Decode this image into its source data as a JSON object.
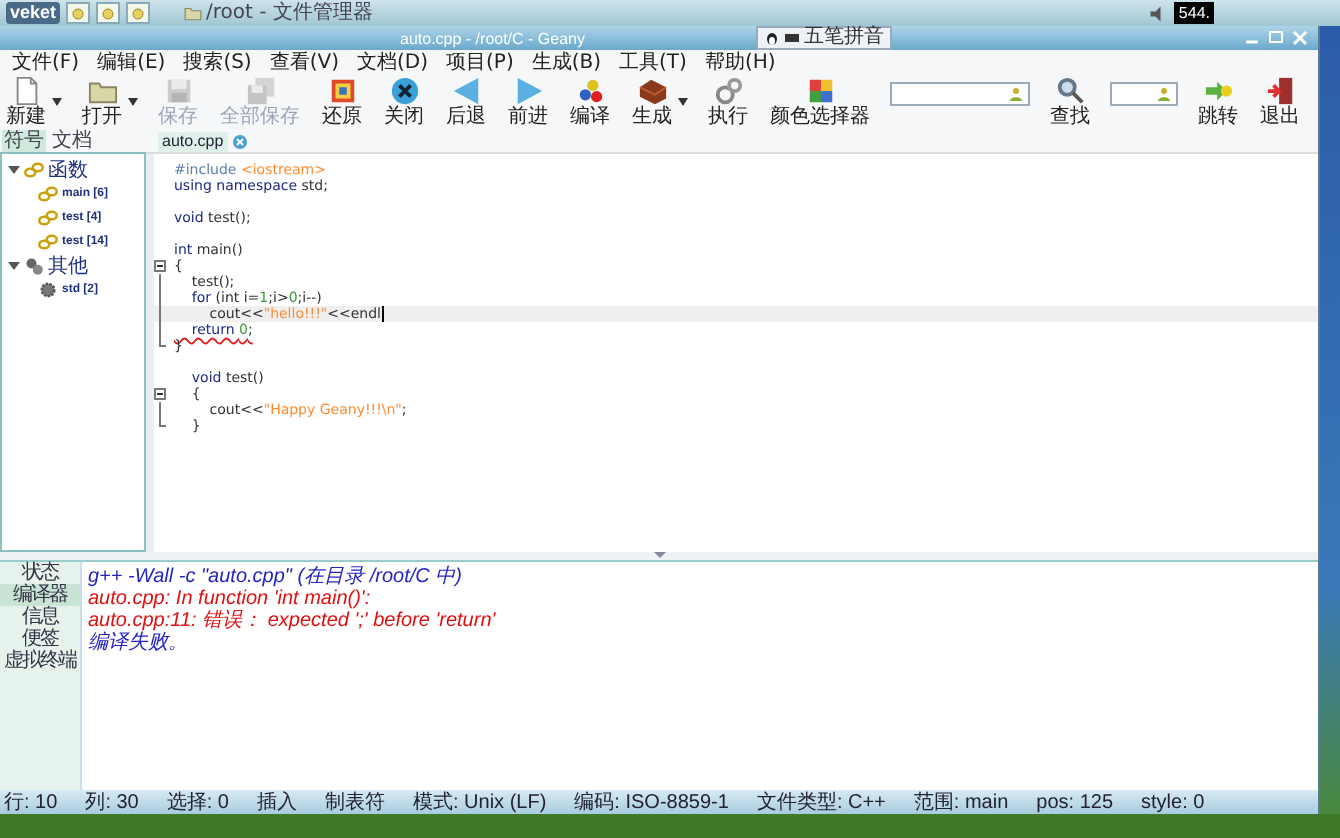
{
  "taskbar": {
    "logo": "veket",
    "tasks": [
      {
        "label": "/root - 文件管理器"
      }
    ],
    "clock": "544."
  },
  "window": {
    "title": "auto.cpp - /root/C - Geany",
    "ime": "五笔拼音"
  },
  "menu": [
    "文件(F)",
    "编辑(E)",
    "搜索(S)",
    "查看(V)",
    "文档(D)",
    "项目(P)",
    "生成(B)",
    "工具(T)",
    "帮助(H)"
  ],
  "toolbar": [
    {
      "kind": "button",
      "label": "新建",
      "disabled": false,
      "dropdown": true
    },
    {
      "kind": "button",
      "label": "打开",
      "disabled": false,
      "dropdown": true
    },
    {
      "kind": "button",
      "label": "保存",
      "disabled": true,
      "dropdown": false
    },
    {
      "kind": "button",
      "label": "全部保存",
      "disabled": true,
      "dropdown": false
    },
    {
      "kind": "button",
      "label": "还原",
      "disabled": false,
      "dropdown": false
    },
    {
      "kind": "button",
      "label": "关闭",
      "disabled": false,
      "dropdown": false
    },
    {
      "kind": "button",
      "label": "后退",
      "disabled": false,
      "dropdown": false
    },
    {
      "kind": "button",
      "label": "前进",
      "disabled": false,
      "dropdown": false
    },
    {
      "kind": "button",
      "label": "编译",
      "disabled": false,
      "dropdown": false
    },
    {
      "kind": "button",
      "label": "生成",
      "disabled": false,
      "dropdown": true
    },
    {
      "kind": "button",
      "label": "执行",
      "disabled": false,
      "dropdown": false
    },
    {
      "kind": "button",
      "label": "颜色选择器",
      "disabled": false,
      "dropdown": false
    },
    {
      "kind": "field"
    },
    {
      "kind": "button",
      "label": "查找",
      "disabled": false,
      "dropdown": false
    },
    {
      "kind": "field"
    },
    {
      "kind": "button",
      "label": "跳转",
      "disabled": false,
      "dropdown": false
    },
    {
      "kind": "button",
      "label": "退出",
      "disabled": false,
      "dropdown": false
    }
  ],
  "sidebar": {
    "tabs": [
      {
        "label": "符号",
        "selected": true
      },
      {
        "label": "文档",
        "selected": false
      }
    ],
    "tree": [
      {
        "label": "函数",
        "expanded": true,
        "children": [
          {
            "label": "main [6]"
          },
          {
            "label": "test [4]"
          },
          {
            "label": "test [14]"
          }
        ]
      },
      {
        "label": "其他",
        "expanded": true,
        "children": [
          {
            "label": "std [2]"
          }
        ]
      }
    ]
  },
  "editor": {
    "tab": "auto.cpp",
    "lines": [
      {
        "kind": "plain",
        "tokens": [
          {
            "kind": "preprocessor",
            "text": "#include "
          },
          {
            "kind": "string",
            "text": "<iostream>"
          }
        ]
      },
      {
        "kind": "plain",
        "tokens": [
          {
            "kind": "keyword",
            "text": "using namespace "
          },
          {
            "kind": "plain",
            "text": "std;"
          }
        ]
      },
      {
        "kind": "blank"
      },
      {
        "kind": "plain",
        "tokens": [
          {
            "kind": "keyword",
            "text": "void "
          },
          {
            "kind": "plain",
            "text": "test();"
          }
        ]
      },
      {
        "kind": "blank"
      },
      {
        "kind": "plain",
        "tokens": [
          {
            "kind": "keyword",
            "text": "int "
          },
          {
            "kind": "plain",
            "text": "main()"
          }
        ]
      },
      {
        "kind": "fold-start",
        "tokens": [
          {
            "kind": "plain",
            "text": "{"
          }
        ]
      },
      {
        "kind": "fold-line",
        "tokens": [
          {
            "kind": "plain",
            "text": "    test();"
          }
        ]
      },
      {
        "kind": "fold-line",
        "tokens": [
          {
            "kind": "keyword",
            "text": "    for "
          },
          {
            "kind": "plain",
            "text": "(int i="
          },
          {
            "kind": "number",
            "text": "1"
          },
          {
            "kind": "plain",
            "text": ";i>"
          },
          {
            "kind": "number",
            "text": "0"
          },
          {
            "kind": "plain",
            "text": ";i--)"
          }
        ]
      },
      {
        "kind": "fold-line",
        "current": true,
        "tokens": [
          {
            "kind": "plain",
            "text": "        cout<<"
          },
          {
            "kind": "string",
            "text": "\"hello!!!\""
          },
          {
            "kind": "plain",
            "text": "<<endl"
          }
        ]
      },
      {
        "kind": "fold-line",
        "error": true,
        "tokens": [
          {
            "kind": "keyword",
            "text": "    return "
          },
          {
            "kind": "number",
            "text": "0"
          },
          {
            "kind": "plain",
            "text": ";"
          }
        ]
      },
      {
        "kind": "fold-end",
        "tokens": [
          {
            "kind": "plain",
            "text": "}"
          }
        ]
      },
      {
        "kind": "blank"
      },
      {
        "kind": "plain",
        "tokens": [
          {
            "kind": "keyword",
            "text": "    void "
          },
          {
            "kind": "plain",
            "text": "test()"
          }
        ]
      },
      {
        "kind": "fold-start",
        "tokens": [
          {
            "kind": "plain",
            "text": "    {"
          }
        ]
      },
      {
        "kind": "fold-line",
        "tokens": [
          {
            "kind": "plain",
            "text": "        cout<<"
          },
          {
            "kind": "string",
            "text": "\"Happy Geany!!!\\n\""
          },
          {
            "kind": "plain",
            "text": ";"
          }
        ]
      },
      {
        "kind": "fold-end",
        "tokens": [
          {
            "kind": "plain",
            "text": "    }"
          }
        ]
      }
    ]
  },
  "panel": {
    "tabs": [
      {
        "label": "状态",
        "selected": false
      },
      {
        "label": "编译器",
        "selected": true
      },
      {
        "label": "信息",
        "selected": false
      },
      {
        "label": "便签",
        "selected": false
      },
      {
        "label": "虚拟终端",
        "selected": false
      }
    ],
    "messages": [
      {
        "kind": "command",
        "text": "g++ -Wall -c \"auto.cpp\" (在目录 /root/C 中)"
      },
      {
        "kind": "error",
        "text": "auto.cpp: In function 'int main()':"
      },
      {
        "kind": "error",
        "text": "auto.cpp:11: 错误： expected ';' before 'return'"
      },
      {
        "kind": "command",
        "text": "编译失败。"
      }
    ]
  },
  "status_bar": [
    "行: 10",
    "列: 30",
    "选择: 0",
    "插入",
    "制表符",
    "模式: Unix (LF)",
    "编码: ISO-8859-1",
    "文件类型: C++",
    "范围: main",
    "pos: 125",
    "style: 0"
  ]
}
